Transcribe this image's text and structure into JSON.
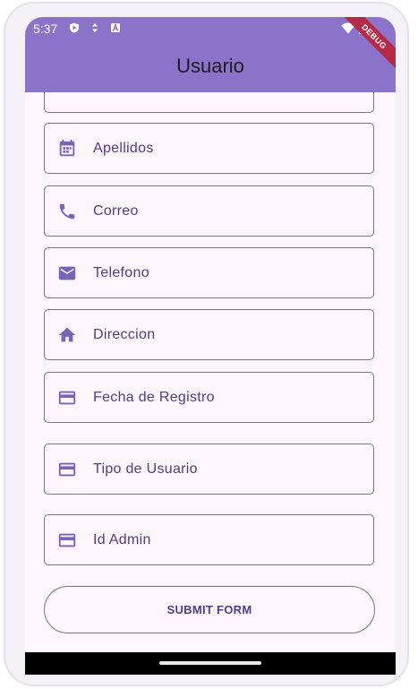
{
  "status_bar": {
    "time": "5:37",
    "icons": [
      "play-protect-icon",
      "data-icon",
      "a-icon",
      "wifi-icon",
      "battery-icon"
    ]
  },
  "debug_banner": "DEBUG",
  "app_bar": {
    "title": "Usuario"
  },
  "form": {
    "fields": [
      {
        "label": "Apellidos",
        "icon": "calendar-icon"
      },
      {
        "label": "Correo",
        "icon": "phone-icon"
      },
      {
        "label": "Telefono",
        "icon": "mail-icon"
      },
      {
        "label": "Direccion",
        "icon": "home-icon"
      },
      {
        "label": "Fecha de Registro",
        "icon": "credit-card-icon"
      },
      {
        "label": "Tipo de Usuario",
        "icon": "credit-card-icon"
      },
      {
        "label": "Id Admin",
        "icon": "credit-card-icon"
      }
    ],
    "submit_label": "SUBMIT FORM"
  },
  "colors": {
    "app_bar": "#8a73c8",
    "accent": "#7a62b8",
    "label": "#4c3f86",
    "background": "#fcf6fd"
  }
}
